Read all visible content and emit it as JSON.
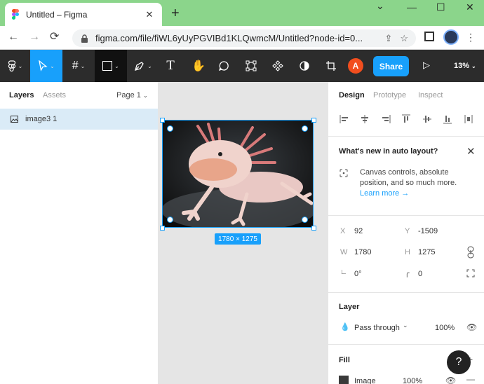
{
  "browser": {
    "tab_title": "Untitled – Figma",
    "tab_close": "✕",
    "new_tab": "+",
    "window_controls": {
      "minimize": "—",
      "maximize": "☐",
      "close": "✕",
      "collapse": "⌄"
    },
    "url": "figma.com/file/fiWL6yUyPGVIBd1KLQwmcM/Untitled?node-id=0..."
  },
  "toolbar": {
    "avatar_letter": "A",
    "share_label": "Share",
    "zoom_label": "13%"
  },
  "left_panel": {
    "tabs": [
      "Layers",
      "Assets"
    ],
    "page_selector": "Page 1",
    "layers": [
      {
        "name": "image3 1"
      }
    ]
  },
  "canvas": {
    "dimension_label": "1780 × 1275"
  },
  "right_panel": {
    "tabs": [
      "Design",
      "Prototype",
      "Inspect"
    ],
    "whats_new": {
      "title": "What's new in auto layout?",
      "body": "Canvas controls, absolute position, and so much more.",
      "link": "Learn more →"
    },
    "properties": {
      "x_label": "X",
      "x_value": "92",
      "y_label": "Y",
      "y_value": "-1509",
      "w_label": "W",
      "w_value": "1780",
      "h_label": "H",
      "h_value": "1275",
      "rotation_value": "0°",
      "radius_value": "0"
    },
    "layer_section": {
      "title": "Layer",
      "blend_mode": "Pass through",
      "opacity": "100%"
    },
    "fill_section": {
      "title": "Fill",
      "fill_type": "Image",
      "fill_opacity": "100%"
    },
    "help_label": "?"
  },
  "colors": {
    "figma_blue": "#18a0fb",
    "chrome_green": "#8bd58b",
    "toolbar_dark": "#2c2c2c",
    "avatar_orange": "#f24e1e"
  }
}
